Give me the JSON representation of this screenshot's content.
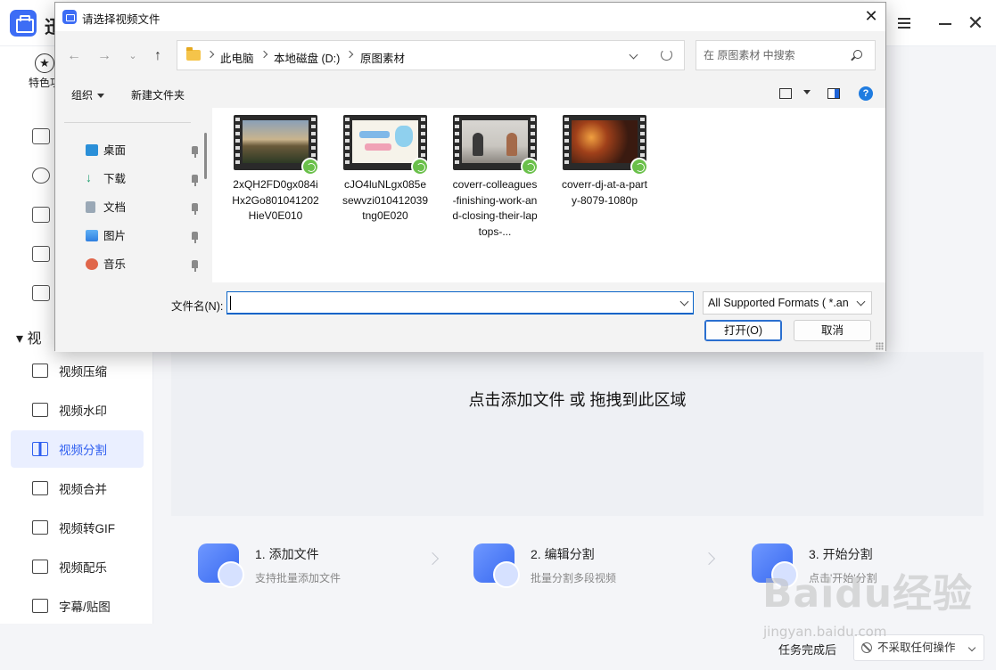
{
  "app": {
    "name": "迅",
    "sidebar": {
      "featured_label": "特色功",
      "section_label": "视",
      "items": [
        {
          "label": "视频压缩"
        },
        {
          "label": "视频水印"
        },
        {
          "label": "视频分割",
          "active": true
        },
        {
          "label": "视频合并"
        },
        {
          "label": "视频转GIF"
        },
        {
          "label": "视频配乐"
        },
        {
          "label": "字幕/贴图"
        }
      ]
    },
    "drop_area_text": "点击添加文件 或 拖拽到此区域",
    "steps": [
      {
        "title": "1. 添加文件",
        "subtitle": "支持批量添加文件"
      },
      {
        "title": "2. 编辑分割",
        "subtitle": "批量分割多段视频"
      },
      {
        "title": "3. 开始分割",
        "subtitle": "点击'开始'分割"
      }
    ],
    "status": {
      "label": "任务完成后",
      "select_value": "不采取任何操作"
    },
    "watermark": {
      "text": "Baidu经验",
      "sub": "jingyan.baidu.com"
    }
  },
  "dialog": {
    "title": "请选择视频文件",
    "breadcrumbs": [
      "此电脑",
      "本地磁盘 (D:)",
      "原图素材"
    ],
    "search_placeholder": "在 原图素材 中搜索",
    "toolbar": {
      "organize": "组织",
      "new_folder": "新建文件夹",
      "help": "?"
    },
    "quick_access": [
      {
        "label": "桌面",
        "icon": "desktop-icon",
        "color": "#2a8fd8"
      },
      {
        "label": "下载",
        "icon": "download-icon",
        "color": "#1e9e6e"
      },
      {
        "label": "文档",
        "icon": "document-icon",
        "color": "#7a8a9a"
      },
      {
        "label": "图片",
        "icon": "picture-icon",
        "color": "#2f7fe0"
      },
      {
        "label": "音乐",
        "icon": "music-icon",
        "color": "#e0664a"
      }
    ],
    "files": [
      {
        "name": "2xQH2FD0gx084iHx2Go801041202HieV0E010",
        "thumb": "sunset-landscape"
      },
      {
        "name": "cJO4luNLgx085esewvzi010412039tng0E020",
        "thumb": "cartoon-cat"
      },
      {
        "name": "coverr-colleagues-finishing-work-and-closing-their-laptops-...",
        "thumb": "office-meeting"
      },
      {
        "name": "coverr-dj-at-a-party-8079-1080p",
        "thumb": "party-lights"
      }
    ],
    "filename_label": "文件名(N):",
    "filename_value": "",
    "format_value": "All Supported Formats ( *.an",
    "open_button": "打开(O)",
    "cancel_button": "取消"
  }
}
